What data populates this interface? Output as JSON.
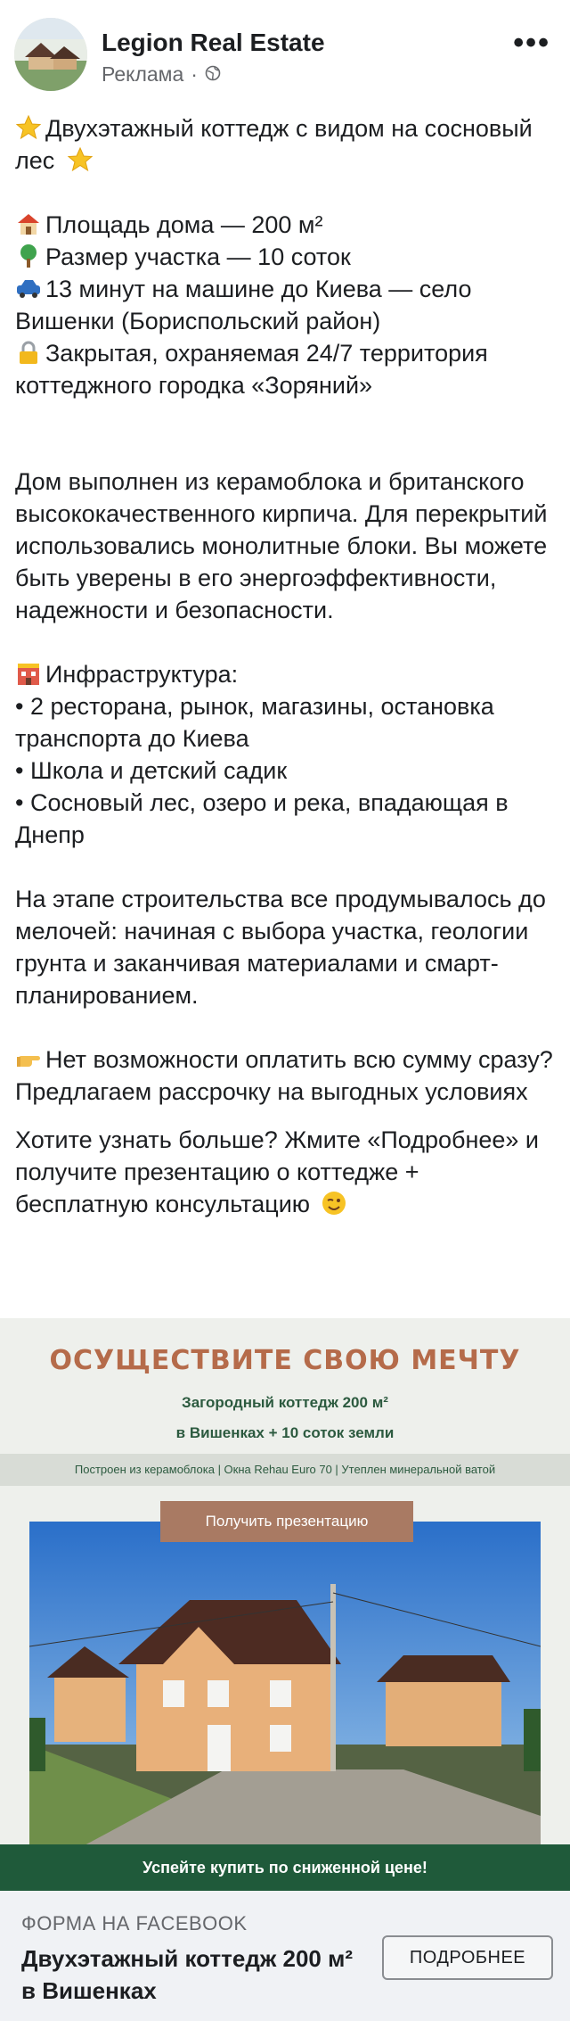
{
  "header": {
    "page_name": "Legion Real Estate",
    "sponsored_label": "Реклама",
    "separator": "·",
    "more_glyph": "•••"
  },
  "post": {
    "headline": "Двухэтажный коттедж с видом на сосновый лес",
    "line_area": "Площадь дома — 200 м²",
    "line_plot": "Размер участка — 10 соток",
    "line_location": "13 минут на машине до Киева — село Вишенки (Бориспольский район)",
    "line_security": "Закрытая, охраняемая 24/7 территория коттеджного городка «Зоряний»",
    "para_material": "Дом выполнен из керамоблока и британского высококачественного кирпича. Для перекрытий использовались монолитные блоки. Вы можете быть уверены в его энергоэффективности, надежности и безопасности.",
    "infra_title": "Инфраструктура:",
    "infra_1": "• 2 ресторана, рынок, магазины, остановка транспорта до Киева",
    "infra_2": "• Школа и детский садик",
    "infra_3": "• Сосновый лес, озеро и река, впадающая в Днепр",
    "para_build": "На этапе строительства все продумывалось до мелочей: начиная с выбора участка, геологии грунта и заканчивая материалами и смарт-планированием.",
    "para_installment": "Нет возможности оплатить всю сумму сразу? Предлагаем рассрочку на выгодных условиях",
    "para_cta": "Хотите узнать больше? Жмите «Подробнее» и получите презентацию о коттедже + бесплатную консультацию"
  },
  "creative": {
    "title": "ОСУЩЕСТВИТЕ СВОЮ МЕЧТУ",
    "subtitle_1": "Загородный коттедж 200 м²",
    "subtitle_2": "в Вишенках + 10 соток земли",
    "features": "Построен из керамоблока | Окна Rehau Euro 70 | Утеплен минеральной ватой",
    "button": "Получить презентацию",
    "bottom_banner": "Успейте купить по сниженной цене!"
  },
  "footer": {
    "label": "ФОРМА НА FACEBOOK",
    "title": "Двухэтажный коттедж 200 м² в Вишенках",
    "button": "ПОДРОБНЕЕ"
  },
  "icons": [
    "star-icon",
    "house-icon",
    "tree-icon",
    "car-icon",
    "lock-icon",
    "building-icon",
    "pointing-hand-icon",
    "wink-face-icon",
    "globe-icon"
  ],
  "colors": {
    "brand_text": "#b56b4a",
    "brand_green": "#1f5a3a",
    "muted": "#65676b",
    "footer_bg": "#f0f2f5"
  }
}
